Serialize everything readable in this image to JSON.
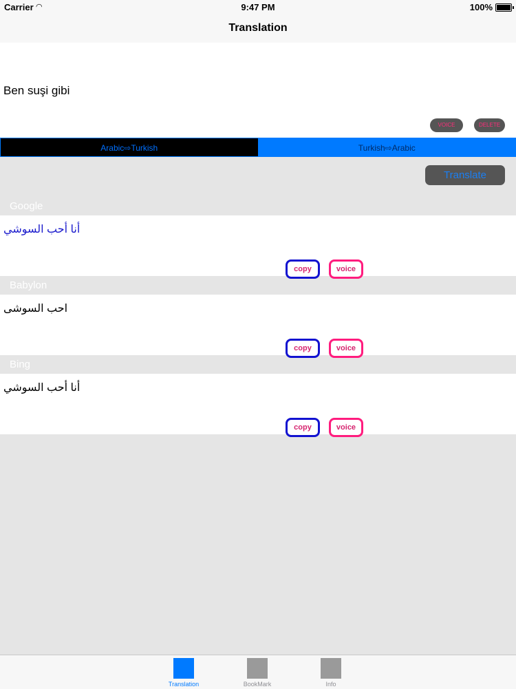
{
  "status": {
    "carrier": "Carrier",
    "time": "9:47 PM",
    "battery": "100%"
  },
  "nav": {
    "title": "Translation"
  },
  "input": {
    "text": "Ben suşi gibi",
    "voice_label": "voice",
    "delete_label": "delete"
  },
  "segments": [
    {
      "label": "Arabic⇨Turkish"
    },
    {
      "label": "Turkish⇨Arabic"
    }
  ],
  "translate_label": "Translate",
  "results": [
    {
      "source": "Google",
      "text": "أنا أحب السوشي",
      "color": "#1a1acc",
      "copy_label": "copy",
      "voice_label": "voice"
    },
    {
      "source": "Babylon",
      "text": "احب السوشى",
      "color": "#000000",
      "copy_label": "copy",
      "voice_label": "voice"
    },
    {
      "source": "Bing",
      "text": "أنا أحب السوشي",
      "color": "#000000",
      "copy_label": "copy",
      "voice_label": "voice"
    }
  ],
  "tabs": [
    {
      "label": "Translation"
    },
    {
      "label": "BookMark"
    },
    {
      "label": "Info"
    }
  ],
  "colors": {
    "accent": "#007aff",
    "pink": "#ff1c7e",
    "copy_border": "#1212d0"
  }
}
